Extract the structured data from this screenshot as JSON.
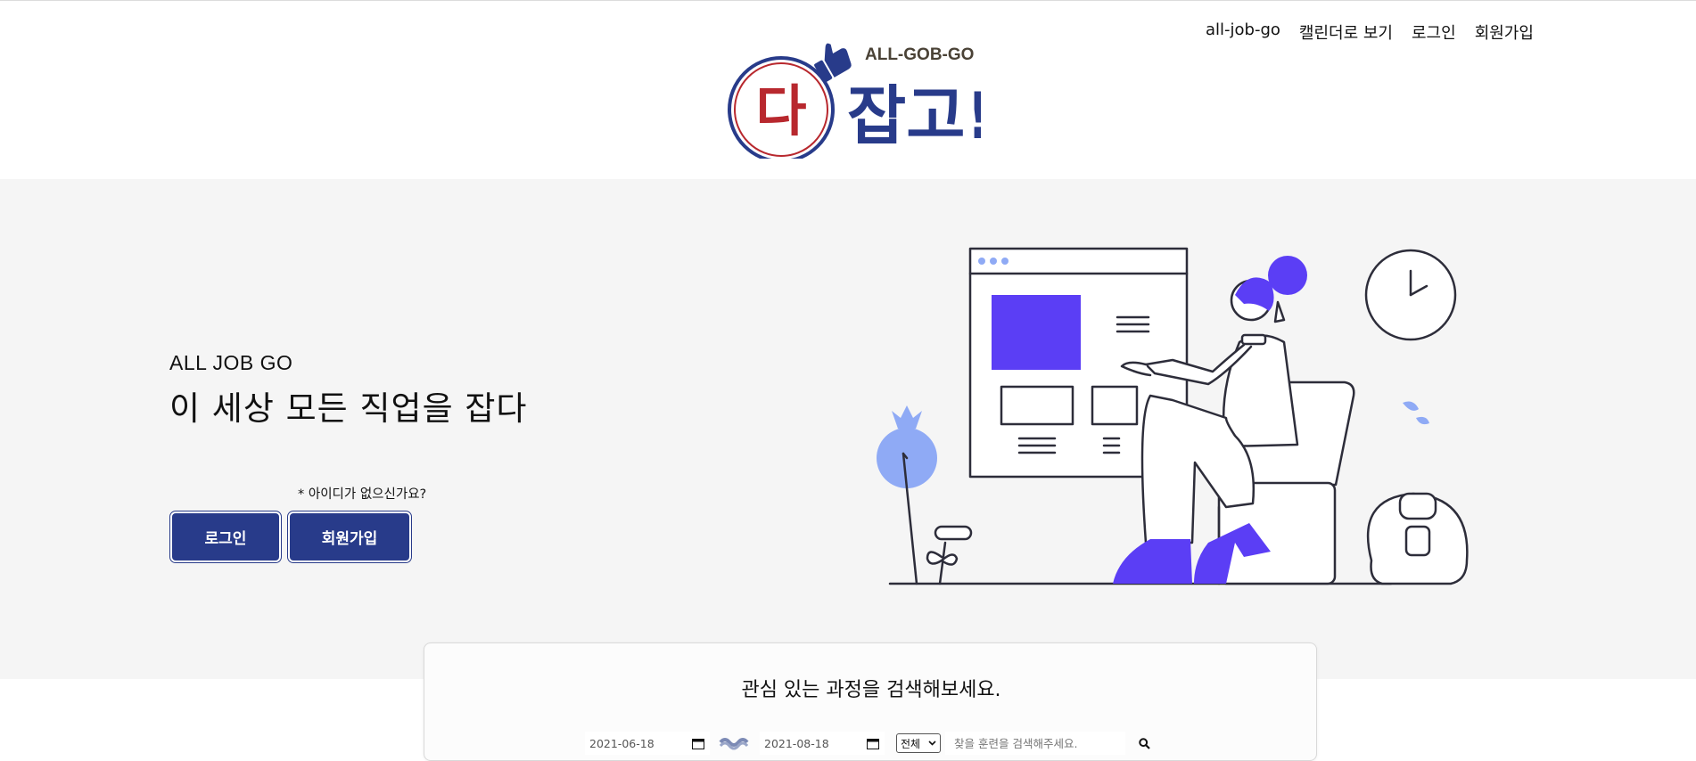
{
  "header": {
    "logo": {
      "brand_en": "ALL-GOB-GO",
      "circle_char": "다",
      "brand_ko": "잡고!"
    },
    "nav": [
      {
        "label": "all-job-go"
      },
      {
        "label": "캘린더로 보기"
      },
      {
        "label": "로그인"
      },
      {
        "label": "회원가입"
      }
    ]
  },
  "hero": {
    "kicker": "ALL JOB GO",
    "title": "이 세상 모든 직업을 잡다",
    "note": "* 아이디가 없으신가요?",
    "login_label": "로그인",
    "signup_label": "회원가입"
  },
  "search": {
    "title": "관심 있는 과정을 검색해보세요.",
    "start_date": "2021-06-18",
    "end_date": "2021-08-18",
    "category_selected": "전체",
    "placeholder": "찾을 훈련을 검색해주세요."
  },
  "colors": {
    "brand_navy": "#283b8a",
    "accent_purple": "#5b3ef5",
    "accent_blue": "#8faaf5",
    "logo_red": "#b8282e",
    "hero_bg": "#f5f5f5"
  },
  "icons": [
    "thumbs-up-icon",
    "calendar-icon",
    "wave-separator-icon",
    "chevron-down-icon",
    "search-icon",
    "clock-icon"
  ]
}
